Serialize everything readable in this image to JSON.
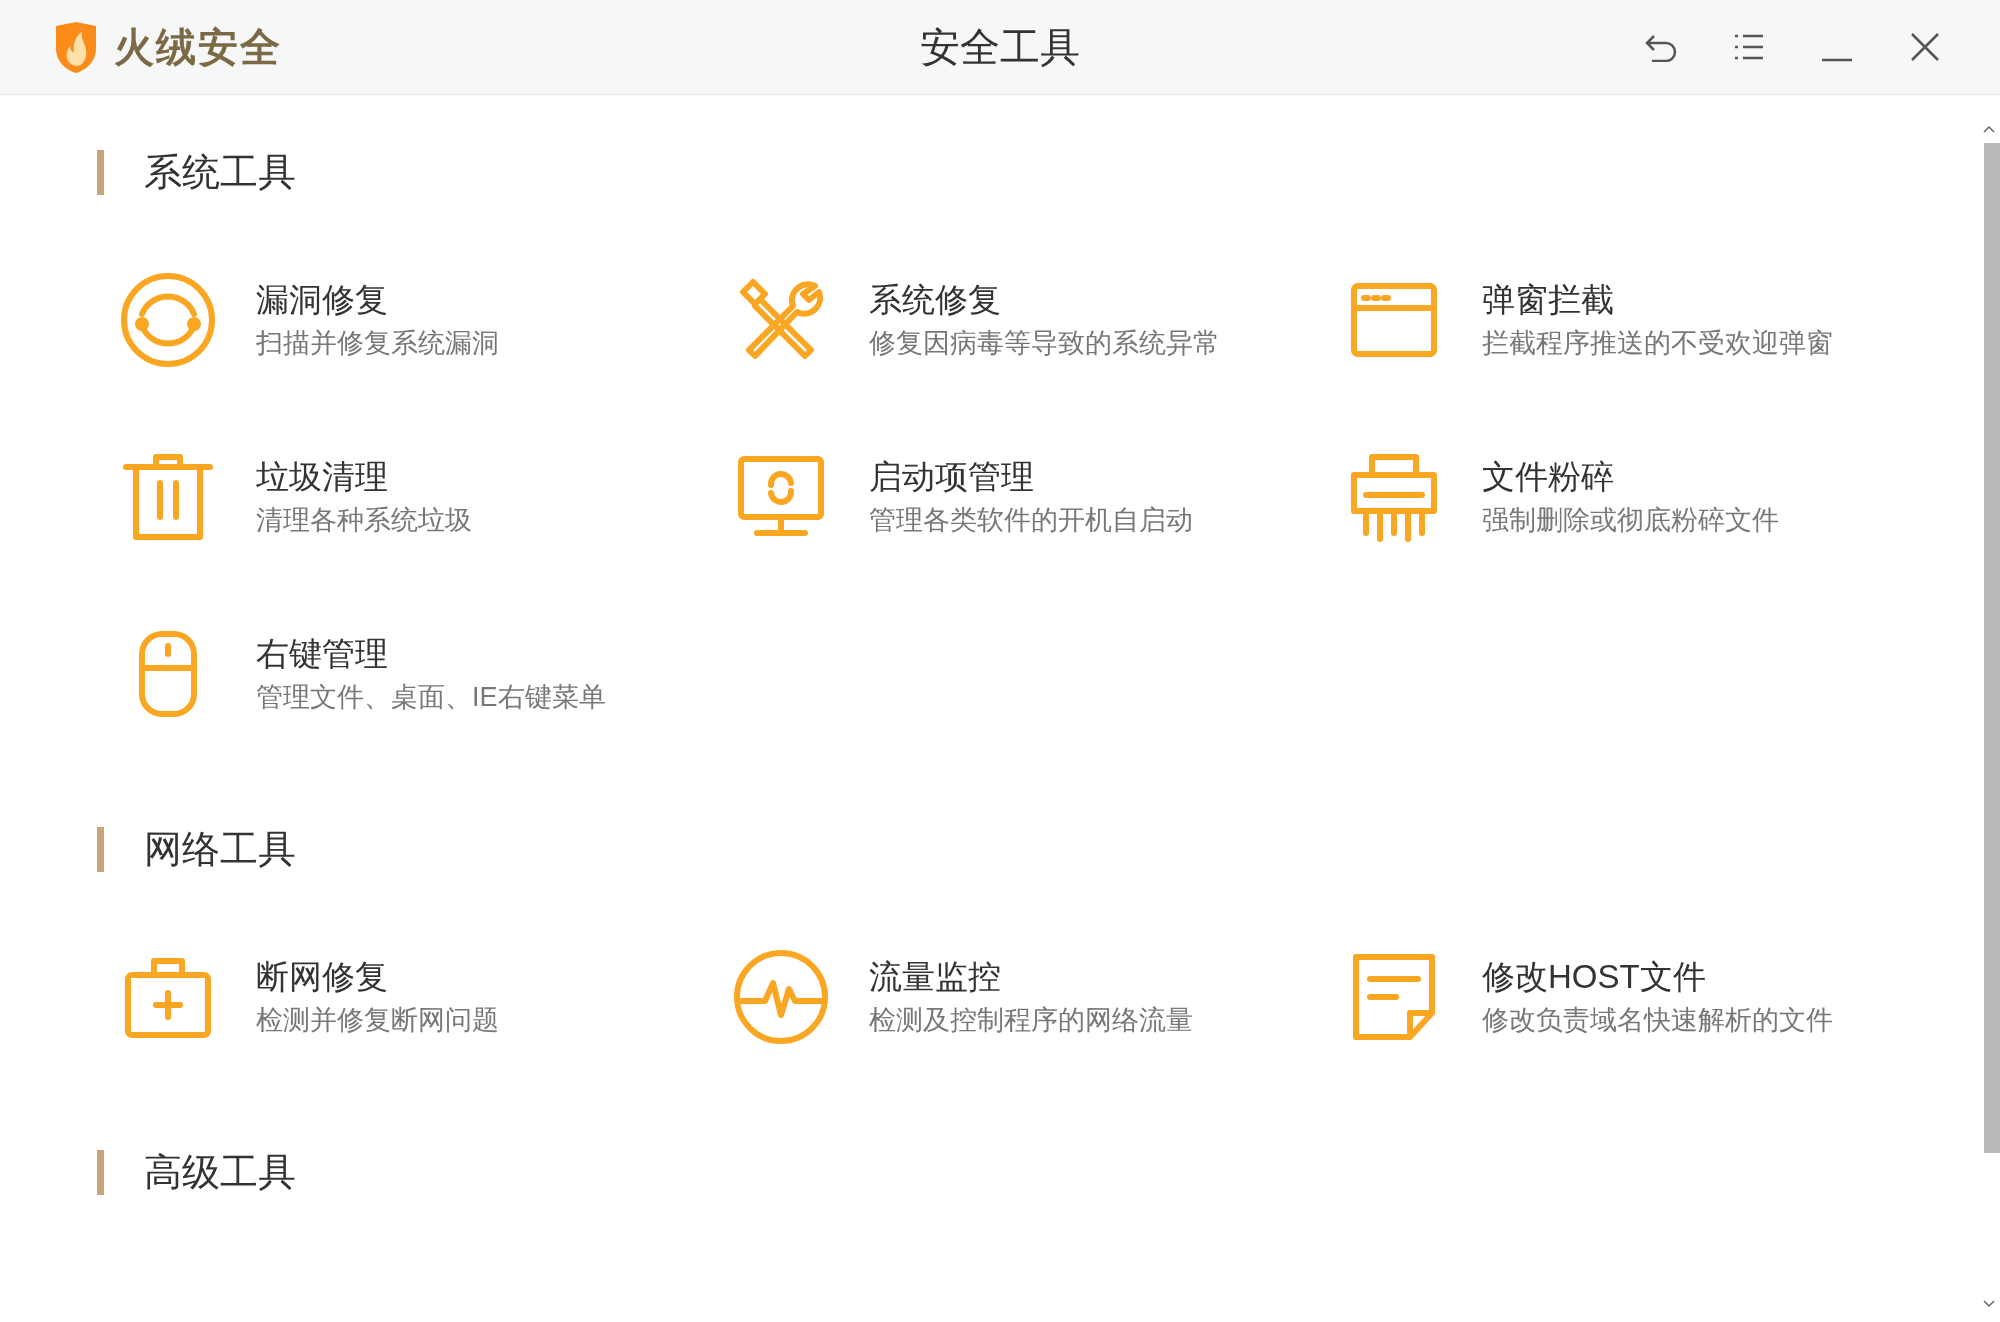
{
  "app_name": "火绒安全",
  "window": {
    "title": "安全工具"
  },
  "sections": [
    {
      "title": "系统工具",
      "tools": [
        {
          "title": "漏洞修复",
          "description": "扫描并修复系统漏洞"
        },
        {
          "title": "系统修复",
          "description": "修复因病毒等导致的系统异常"
        },
        {
          "title": "弹窗拦截",
          "description": "拦截程序推送的不受欢迎弹窗"
        },
        {
          "title": "垃圾清理",
          "description": "清理各种系统垃圾"
        },
        {
          "title": "启动项管理",
          "description": "管理各类软件的开机自启动"
        },
        {
          "title": "文件粉碎",
          "description": "强制删除或彻底粉碎文件"
        },
        {
          "title": "右键管理",
          "description": "管理文件、桌面、IE右键菜单"
        }
      ]
    },
    {
      "title": "网络工具",
      "tools": [
        {
          "title": "断网修复",
          "description": "检测并修复断网问题"
        },
        {
          "title": "流量监控",
          "description": "检测及控制程序的网络流量"
        },
        {
          "title": "修改HOST文件",
          "description": "修改负责域名快速解析的文件"
        }
      ]
    },
    {
      "title": "高级工具"
    }
  ]
}
